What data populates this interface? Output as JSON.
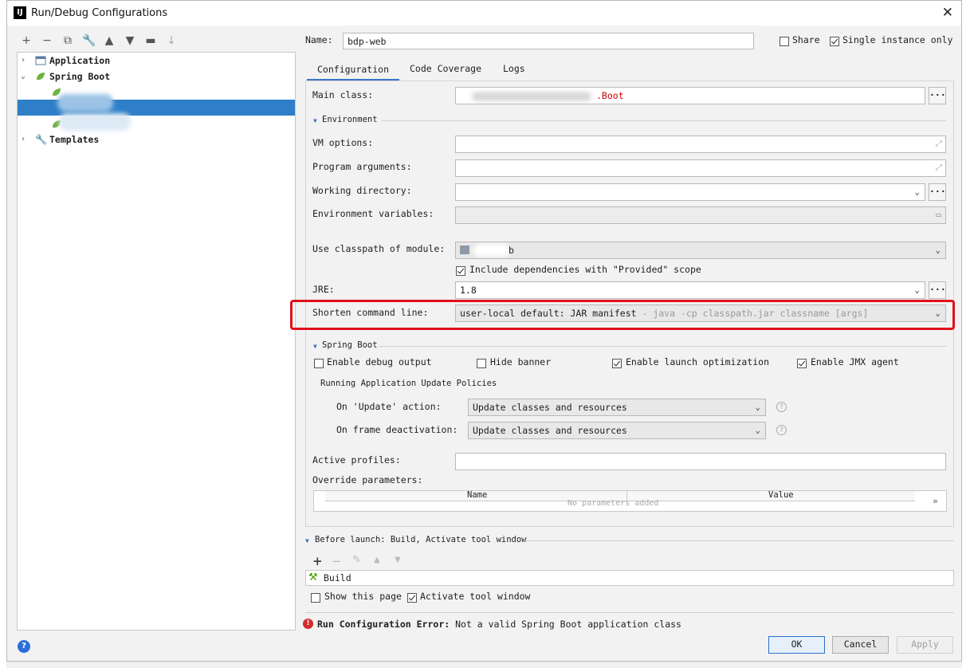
{
  "window": {
    "title": "Run/Debug Configurations",
    "logo": "IJ"
  },
  "toolbar": {
    "icons": [
      "add-icon",
      "remove-icon",
      "copy-icon",
      "wrench-icon",
      "arrow-up-icon",
      "arrow-down-icon",
      "folder-icon",
      "sort-icon"
    ]
  },
  "tree": {
    "application": "Application",
    "spring_boot": "Spring Boot",
    "templates": "Templates"
  },
  "header": {
    "name_label": "Name:",
    "name_value": "bdp-web",
    "share_label": "Share",
    "share_checked": false,
    "single_instance_label": "Single instance only",
    "single_instance_checked": true
  },
  "tabs": [
    "Configuration",
    "Code Coverage",
    "Logs"
  ],
  "form": {
    "main_class_label": "Main class:",
    "main_class_suffix": ".Boot",
    "environment_label": "Environment",
    "vm_options_label": "VM options:",
    "program_args_label": "Program arguments:",
    "working_dir_label": "Working directory:",
    "env_vars_label": "Environment variables:",
    "classpath_label": "Use classpath of module:",
    "classpath_value": "b",
    "include_deps_label": "Include dependencies with \"Provided\" scope",
    "jre_label": "JRE:",
    "jre_value": "1.8",
    "shorten_label": "Shorten command line:",
    "shorten_value": "user-local default: JAR manifest",
    "shorten_hint": " - java -cp classpath.jar classname [args]"
  },
  "spring_boot": {
    "section_label": "Spring Boot",
    "enable_debug_label": "Enable debug output",
    "hide_banner_label": "Hide banner",
    "launch_opt_label": "Enable launch optimization",
    "jmx_label": "Enable JMX agent",
    "policies_label": "Running Application Update Policies",
    "on_update_label": "On 'Update' action:",
    "on_update_value": "Update classes and resources",
    "on_frame_label": "On frame deactivation:",
    "on_frame_value": "Update classes and resources",
    "active_profiles_label": "Active profiles:",
    "override_label": "Override parameters:",
    "table_cols": [
      "Name",
      "Value"
    ],
    "table_empty": "No parameters added"
  },
  "before_launch": {
    "label": "Before launch: Build, Activate tool window",
    "build_label": "Build",
    "show_page_label": "Show this page",
    "activate_label": "Activate tool window"
  },
  "error": {
    "bold": "Run Configuration Error:",
    "message": " Not a valid Spring Boot application class"
  },
  "buttons": {
    "ok": "OK",
    "cancel": "Cancel",
    "apply": "Apply"
  },
  "colors": {
    "accent": "#2f7fc8",
    "highlight": "#e0101a",
    "error": "#c00000"
  }
}
